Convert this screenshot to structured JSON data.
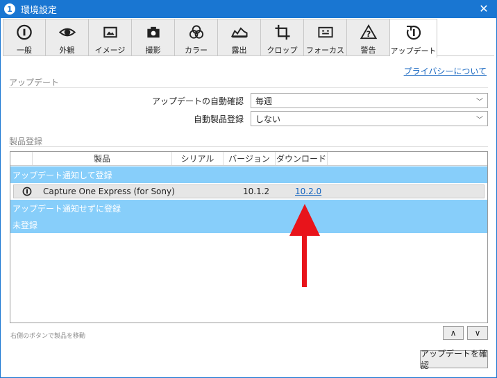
{
  "window": {
    "title": "環境設定",
    "close_glyph": "✕",
    "app_icon_glyph": "1"
  },
  "tabs": [
    {
      "label": "一般",
      "icon": "info-circle-icon"
    },
    {
      "label": "外観",
      "icon": "eye-icon"
    },
    {
      "label": "イメージ",
      "icon": "image-icon"
    },
    {
      "label": "撮影",
      "icon": "camera-icon"
    },
    {
      "label": "カラー",
      "icon": "color-circles-icon"
    },
    {
      "label": "露出",
      "icon": "histogram-icon"
    },
    {
      "label": "クロップ",
      "icon": "crop-icon"
    },
    {
      "label": "フォーカス",
      "icon": "focus-icon"
    },
    {
      "label": "警告",
      "icon": "warning-icon"
    },
    {
      "label": "アップデート",
      "icon": "update-icon",
      "active": true
    }
  ],
  "privacy_link": "プライバシーについて",
  "update_section": {
    "heading": "アップデート",
    "auto_check_label": "アップデートの自動確認",
    "auto_check_value": "毎週",
    "auto_register_label": "自動製品登録",
    "auto_register_value": "しない"
  },
  "product_section": {
    "heading": "製品登録",
    "columns": [
      "製品",
      "シリアル",
      "バージョン",
      "ダウンロード"
    ],
    "groups": [
      {
        "label": "アップデート通知して登録",
        "rows": [
          {
            "name": "Capture One Express (for Sony)",
            "serial": "",
            "version": "10.1.2",
            "download": "10.2.0"
          }
        ]
      },
      {
        "label": "アップデート通知せずに登録",
        "rows": []
      },
      {
        "label": "未登録",
        "rows": []
      }
    ]
  },
  "footer": {
    "hint": "右側のボタンで製品を移動",
    "up_label": "∧",
    "down_label": "∨",
    "check_button": "アップデートを確認"
  },
  "colors": {
    "titlebar": "#1976d2",
    "group_row": "#87cefa",
    "arrow": "#e8141b",
    "link": "#1565c0"
  }
}
